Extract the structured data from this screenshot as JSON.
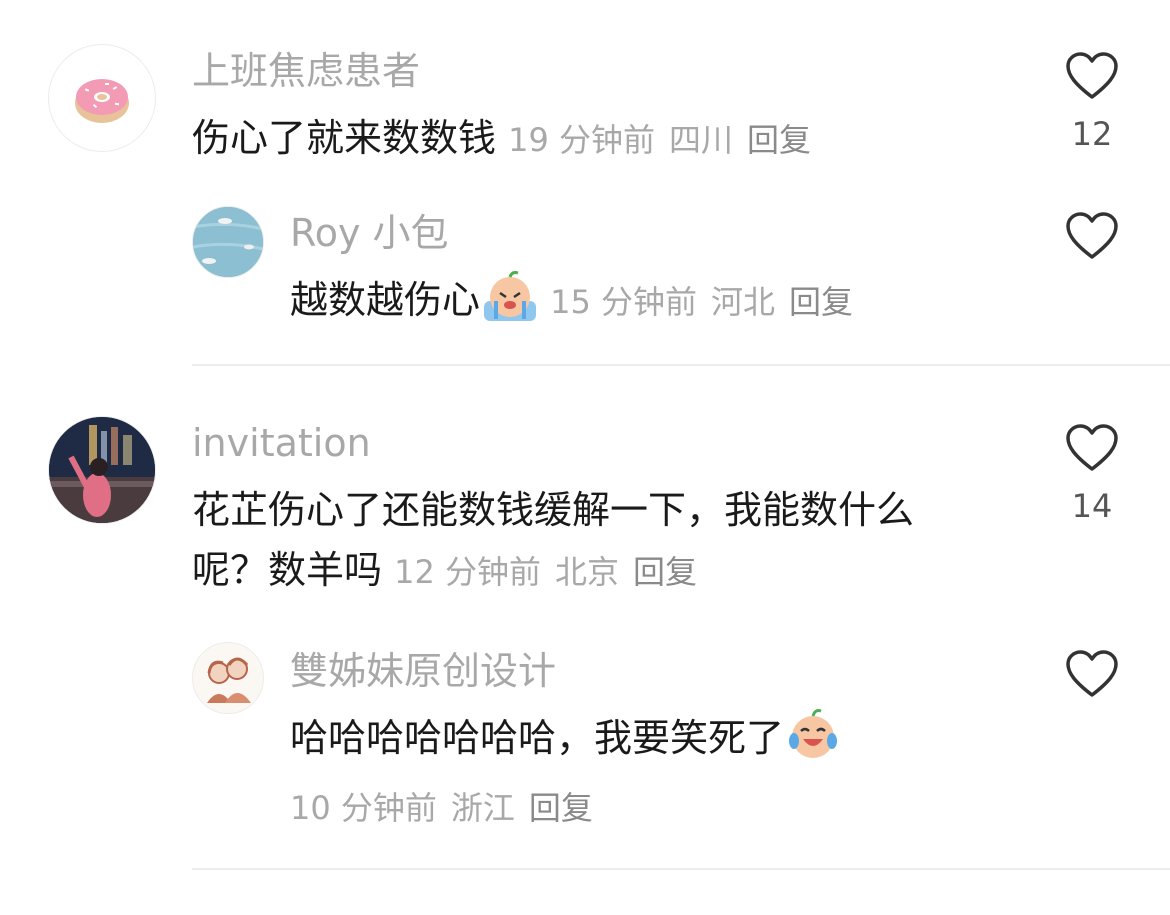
{
  "comments": [
    {
      "avatar_icon": "donut-icon",
      "username": "上班焦虑患者",
      "text": "伤心了就来数数钱",
      "time": "19 分钟前",
      "location": "四川",
      "reply_label": "回复",
      "likes": "12",
      "replies": [
        {
          "avatar_icon": "seagulls-photo-icon",
          "username": "Roy 小包",
          "text": "越数越伤心",
          "emoji_icon": "crying-face-emoji",
          "time": "15 分钟前",
          "location": "河北",
          "reply_label": "回复",
          "likes": ""
        }
      ]
    },
    {
      "avatar_icon": "night-city-photo-icon",
      "username": "invitation",
      "text_line1": "花芷伤心了还能数钱缓解一下，我能数什么",
      "text_line2": "呢？数羊吗",
      "time": "12 分钟前",
      "location": "北京",
      "reply_label": "回复",
      "likes": "14",
      "replies": [
        {
          "avatar_icon": "sisters-illustration-icon",
          "username": "雙姊妹原创设计",
          "text": "哈哈哈哈哈哈哈，我要笑死了",
          "emoji_icon": "laughing-tears-emoji",
          "time": "10 分钟前",
          "location": "浙江",
          "reply_label": "回复",
          "likes": ""
        }
      ]
    }
  ]
}
